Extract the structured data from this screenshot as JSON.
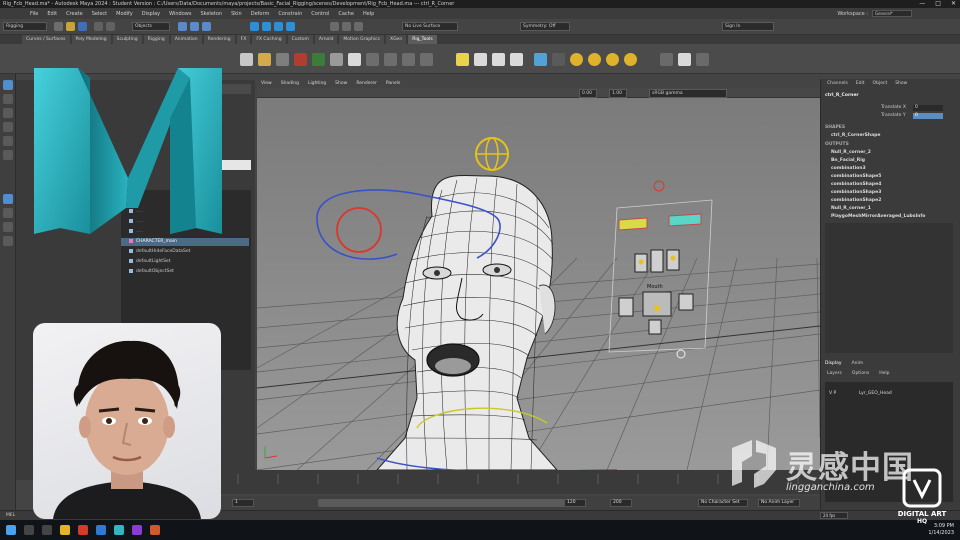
{
  "window": {
    "title": "Rig_Fcb_Head.ma* - Autodesk Maya 2024 : Student Version : C:/Users/Data/Documents/maya/projects/Basic_Facial_Rigging/scenes/Development/Rig_Fcb_Head.ma --- ctrl_R_Corner",
    "controls": [
      "—",
      "□",
      "✕"
    ]
  },
  "menubar": {
    "items": [
      "File",
      "Edit",
      "Create",
      "Select",
      "Modify",
      "Display",
      "Windows",
      "Skeleton",
      "Skin",
      "Deform",
      "Constrain",
      "Control",
      "Cache",
      "Help"
    ],
    "workspace_label": "Workspace :",
    "workspace_value": "General*"
  },
  "statusline": {
    "menuset": "Rigging",
    "objects": "Objects",
    "no_live_surface": "No Live Surface",
    "symmetry": "Symmetry: Off",
    "sign_in": "Sign In"
  },
  "shelf": {
    "tabs": [
      "Curves / Surfaces",
      "Poly Modeling",
      "Sculpting",
      "Rigging",
      "Animation",
      "Rendering",
      "FX",
      "FX Caching",
      "Custom",
      "Arnold",
      "Motion Graphics",
      "XGen",
      "Rig_Tools"
    ],
    "active_tab": "Rig_Tools"
  },
  "viewport": {
    "menu": [
      "View",
      "Shading",
      "Lighting",
      "Show",
      "Renderer",
      "Panels"
    ],
    "gamma": "sRGB gamma",
    "field_a": "0.00",
    "field_b": "1.00",
    "mouth_label": "Mouth"
  },
  "outliner": {
    "items": [
      {
        "label": "CHARACTER_main",
        "selected": true
      },
      {
        "label": "defaultHideFaceDataSet",
        "selected": false
      },
      {
        "label": "defaultLightSet",
        "selected": false
      },
      {
        "label": "defaultObjectSet",
        "selected": false
      }
    ]
  },
  "channelbox": {
    "menu": [
      "Channels",
      "Edit",
      "Object",
      "Show"
    ],
    "node": "ctrl_R_Corner",
    "attrs": [
      {
        "name": "Translate X",
        "value": "0"
      },
      {
        "name": "Translate Y",
        "value": "0"
      }
    ],
    "shapes_header": "SHAPES",
    "shapes": [
      "ctrl_R_CornerShape"
    ],
    "outputs_header": "OUTPUTS",
    "outputs": [
      "Null_R_corner_2",
      "Bn_Facial_Rig",
      "combination3",
      "combinationShape5",
      "combinationShape4",
      "combinationShape3",
      "combinationShape2",
      "Null_R_corner_1",
      "PlaygoMeshMirrorAveraged_LubsInfo"
    ],
    "layer_tabs": [
      "Display",
      "Anim"
    ],
    "layer_menu": [
      "Layers",
      "Options",
      "Help"
    ],
    "layer_flags": "V  P",
    "layer_name": "Lyr_GEO_Head"
  },
  "timeline": {
    "start": "1",
    "end": "120",
    "range_start": "120",
    "range_end": "200",
    "fps": "24 fps",
    "character_set": "No Character Set",
    "anim_layer": "No Anim Layer"
  },
  "cmdline": {
    "label": "MEL"
  },
  "taskbar": {
    "time": "3:09 PM",
    "date": "1/14/2023"
  },
  "watermark": {
    "brand": "灵感中国",
    "url": "lingganchina.com",
    "badge_line1": "DIGITAL ART",
    "badge_line2": "HQ"
  },
  "colors": {
    "maya_teal": "#2fb7c4",
    "maya_teal_dark": "#137f8c",
    "selection_blue": "#4d6a85",
    "highlight_blue": "#5c8dc2",
    "ctrl_yellow": "#e8c21a",
    "ctrl_red": "#d9382e",
    "ctrl_blue": "#3a52c8"
  }
}
